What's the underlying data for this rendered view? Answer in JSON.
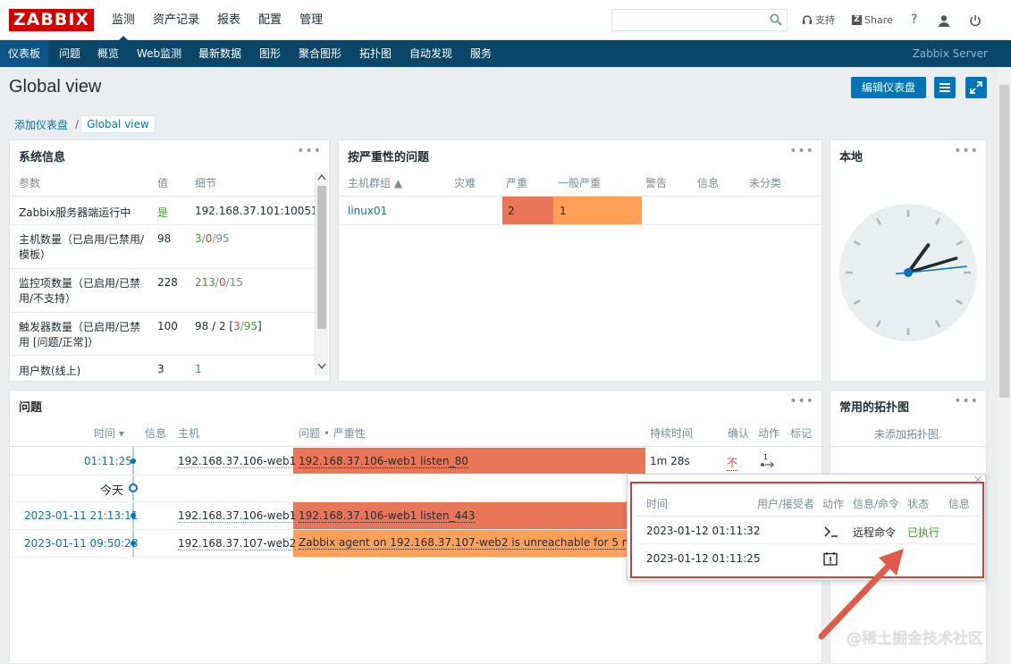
{
  "brand": {
    "logo": "ZABBIX"
  },
  "main_menu": [
    {
      "label": "监测",
      "active": true
    },
    {
      "label": "资产记录"
    },
    {
      "label": "报表"
    },
    {
      "label": "配置"
    },
    {
      "label": "管理"
    }
  ],
  "header": {
    "support": "支持",
    "share": "Share",
    "help": "?"
  },
  "sub_menu": [
    {
      "label": "仪表板",
      "active": true
    },
    {
      "label": "问题"
    },
    {
      "label": "概览"
    },
    {
      "label": "Web监测"
    },
    {
      "label": "最新数据"
    },
    {
      "label": "图形"
    },
    {
      "label": "聚合图形"
    },
    {
      "label": "拓扑图"
    },
    {
      "label": "自动发现"
    },
    {
      "label": "服务"
    }
  ],
  "server_name": "Zabbix Server",
  "page": {
    "title": "Global view",
    "edit_button": "编辑仪表盘"
  },
  "breadcrumb": {
    "parent": "添加仪表盘",
    "separator": "/",
    "current": "Global view"
  },
  "widget_menu_glyph": "•••",
  "system_info": {
    "title": "系统信息",
    "columns": [
      "参数",
      "值",
      "细节"
    ],
    "rows": [
      {
        "param": "Zabbix服务器端运行中",
        "value": "是",
        "detail": "192.168.37.101:10051"
      },
      {
        "param": "主机数量（已启用/已禁用/模板）",
        "value": "98",
        "d1": "3",
        "s1": "/",
        "d2": "0",
        "s2": "/",
        "d3": "95"
      },
      {
        "param": "监控项数量（已启用/已禁用/不支持）",
        "value": "228",
        "d1": "213",
        "s1": "/",
        "d2": "0",
        "s2": "/",
        "d3": "15"
      },
      {
        "param": "触发器数量（已启用/已禁用 [问题/正常]）",
        "value": "100",
        "d0": "98 / 2 [",
        "d1": "3",
        "s1": "/",
        "d2": "95",
        "s2": "]"
      },
      {
        "param": "用户数(线上)",
        "value": "3",
        "detail": "1"
      }
    ]
  },
  "problems_by_severity": {
    "title": "按严重性的问题",
    "columns": [
      "主机群组 ▲",
      "灾难",
      "严重",
      "一般严重",
      "警告",
      "信息",
      "未分类"
    ],
    "row": {
      "group": "linux01",
      "high": "2",
      "average": "1"
    }
  },
  "local_clock": {
    "title": "本地",
    "hour": 1,
    "minute": 12,
    "second": 14
  },
  "problems": {
    "title": "问题",
    "columns": [
      "时间 ▾",
      "信息",
      "主机",
      "问题 • 严重性",
      "持续时间",
      "确认",
      "动作",
      "标记"
    ],
    "rows": [
      {
        "time": "01:11:25",
        "host": "192.168.37.106-web1",
        "problem": "192.168.37.106-web1 listen_80",
        "duration": "1m 28s",
        "ack": "不",
        "action_count": "1",
        "severity": "high"
      },
      {
        "time": "2023-01-11 21:13:11",
        "host": "192.168.37.106-web1",
        "problem": "192.168.37.106-web1 listen_443",
        "severity": "high"
      },
      {
        "time": "2023-01-11 09:50:28",
        "host": "192.168.37.107-web2",
        "problem": "Zabbix agent on 192.168.37.107-web2 is unreachable for 5 minutes",
        "severity": "average"
      }
    ],
    "today_label": "今天"
  },
  "fav_maps": {
    "title": "常用的拓扑图",
    "empty": "未添加拓扑图."
  },
  "action_popup": {
    "close": "×",
    "columns": [
      "时间",
      "用户/接受者",
      "动作",
      "信息/命令",
      "状态",
      "信息"
    ],
    "rows": [
      {
        "time": "2023-01-12 01:11:32",
        "command": "远程命令",
        "status": "已执行"
      },
      {
        "time": "2023-01-12 01:11:25"
      }
    ]
  },
  "watermark": "@稀土掘金技术社区",
  "colors": {
    "accent": "#0275b8",
    "nav": "#0a466a",
    "high": "#e97659",
    "average": "#ffa059",
    "brand": "#d40000"
  }
}
